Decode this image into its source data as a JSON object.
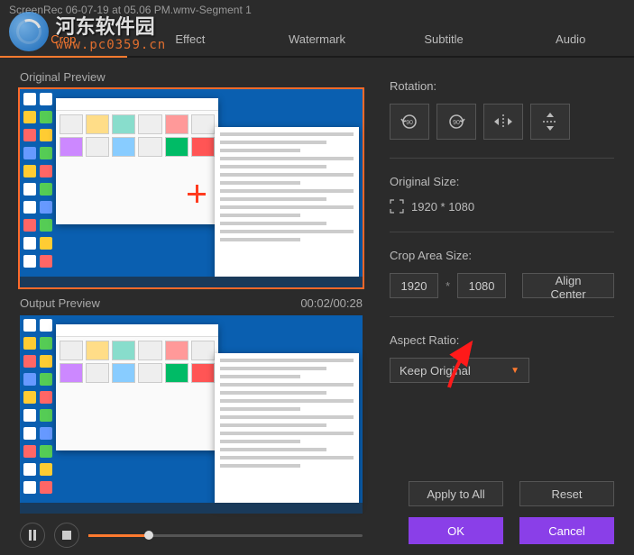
{
  "title": "ScreenRec 06-07-19 at 05.06 PM.wmv-Segment 1",
  "tabs": {
    "crop": "Crop",
    "effect": "Effect",
    "watermark": "Watermark",
    "subtitle": "Subtitle",
    "audio": "Audio"
  },
  "labels": {
    "original_preview": "Original Preview",
    "output_preview": "Output Preview",
    "timecode": "00:02/00:28",
    "rotation": "Rotation:",
    "original_size": "Original Size:",
    "original_size_value": "1920 * 1080",
    "crop_area": "Crop Area Size:",
    "aspect_ratio": "Aspect Ratio:"
  },
  "crop": {
    "width": "1920",
    "height": "1080",
    "align_center": "Align Center"
  },
  "aspect": {
    "selected": "Keep Original"
  },
  "buttons": {
    "apply_all": "Apply to All",
    "reset": "Reset",
    "ok": "OK",
    "cancel": "Cancel"
  },
  "watermark": {
    "cn": "河东软件园",
    "url": "www.pc0359.cn"
  }
}
